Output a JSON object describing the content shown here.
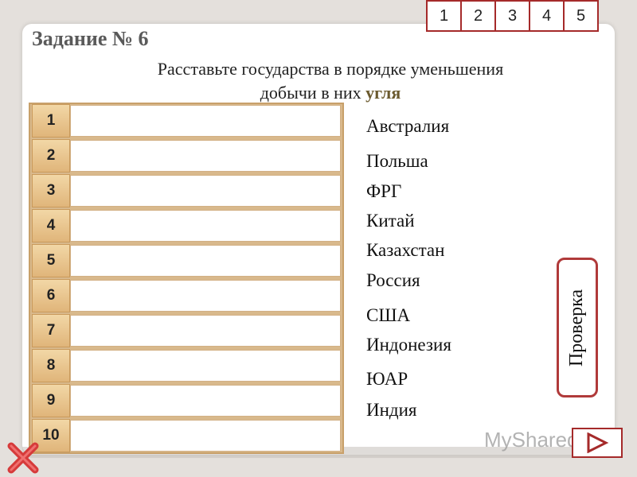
{
  "header": {
    "title": "Задание № 6",
    "instruction_line1": "Расставьте государства в порядке уменьшения",
    "instruction_line2_prefix": "добычи в них",
    "instruction_line2_highlight": "угля"
  },
  "nav": {
    "pages": [
      "1",
      "2",
      "3",
      "4",
      "5"
    ]
  },
  "slots": [
    "1",
    "2",
    "3",
    "4",
    "5",
    "6",
    "7",
    "8",
    "9",
    "10"
  ],
  "countries": [
    "Австралия",
    "Польша",
    "ФРГ",
    "Китай",
    "Казахстан",
    "Россия",
    "США",
    "Индонезия",
    "ЮАР",
    "Индия"
  ],
  "check_button": "Проверка",
  "watermark": "MyShared",
  "colors": {
    "accent": "#a52a2a",
    "slot_number_bg": "#e0b57a",
    "close_icon": "#d63a3a"
  }
}
